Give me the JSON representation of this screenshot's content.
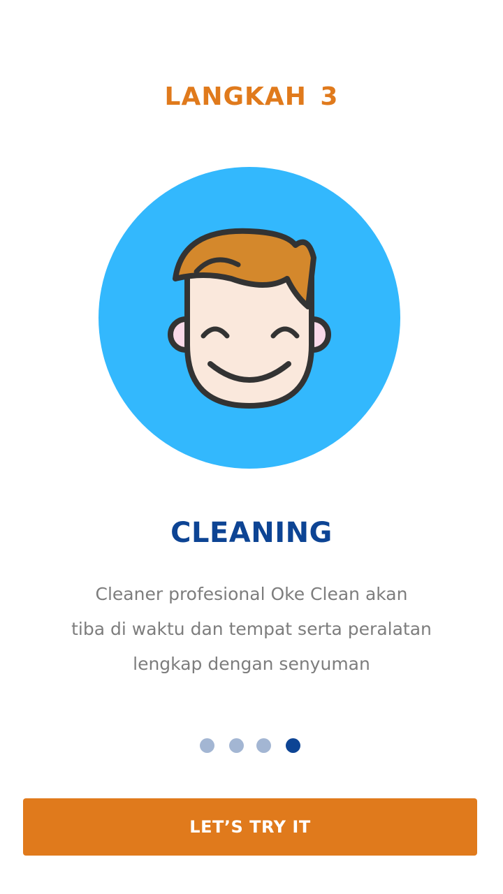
{
  "onboarding": {
    "step_title": "LANGKAH 3",
    "illustration_icon": "smiling-face-icon",
    "heading": "CLEANING",
    "description_lines": [
      "Cleaner profesional Oke Clean akan",
      "tiba di waktu dan tempat serta peralatan",
      "lengkap dengan senyuman"
    ],
    "page_indicator": {
      "total": 4,
      "current": 4
    },
    "cta_label": "LET’S TRY IT"
  },
  "colors": {
    "accent_orange": "#e07a1c",
    "heading_blue": "#0d4494",
    "circle_blue": "#33b8fd",
    "dot_inactive": "#a3b6d3",
    "body_text": "#7d7d7d"
  }
}
